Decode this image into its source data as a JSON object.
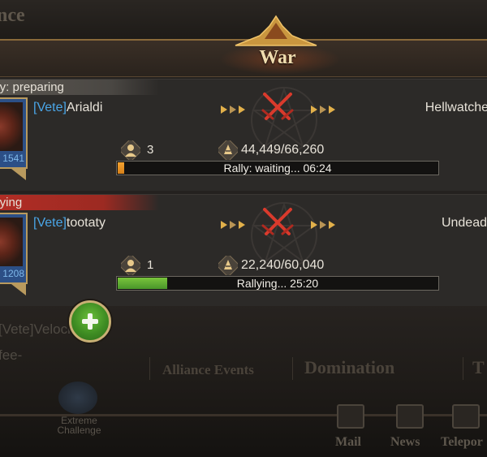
{
  "background": {
    "top_label": "nce",
    "member_line": "[Vete]Velociteam",
    "member_line2": "fee-",
    "tabs": [
      "Alliance Events",
      "Domination",
      "T"
    ],
    "extreme_challenge": "Extreme Challenge",
    "nav": [
      "Mail",
      "News",
      "Telepor"
    ]
  },
  "modal": {
    "title": "War",
    "rallies": [
      {
        "status": "lly: preparing",
        "status_type": "preparing",
        "player_tag": "[Vete]",
        "player_name": "Arialdi",
        "power_fragment": "1541",
        "target": "Hellwatche",
        "members": "3",
        "troops": "44,449/66,260",
        "progress_fraction": 0.02,
        "progress_text": "Rally: waiting... 06:24",
        "progress_color": "#f5a330"
      },
      {
        "status": "llying",
        "status_type": "rallying",
        "player_tag": "[Vete]",
        "player_name": "tootaty",
        "power_fragment": "1208",
        "target": "Undead",
        "members": "1",
        "troops": "22,240/60,040",
        "progress_fraction": 0.155,
        "progress_text": "Rallying... 25:20",
        "progress_color": "#79c43c"
      }
    ]
  },
  "icons": {
    "member": "member-icon",
    "troops": "troop-icon",
    "swords": "crossed-swords-icon",
    "join": "plus-icon"
  },
  "colors": {
    "title": "#f0dcae",
    "tag": "#4aa6e8",
    "rallying_ribbon": "#b12d25",
    "preparing_ribbon": "#5a5650"
  }
}
